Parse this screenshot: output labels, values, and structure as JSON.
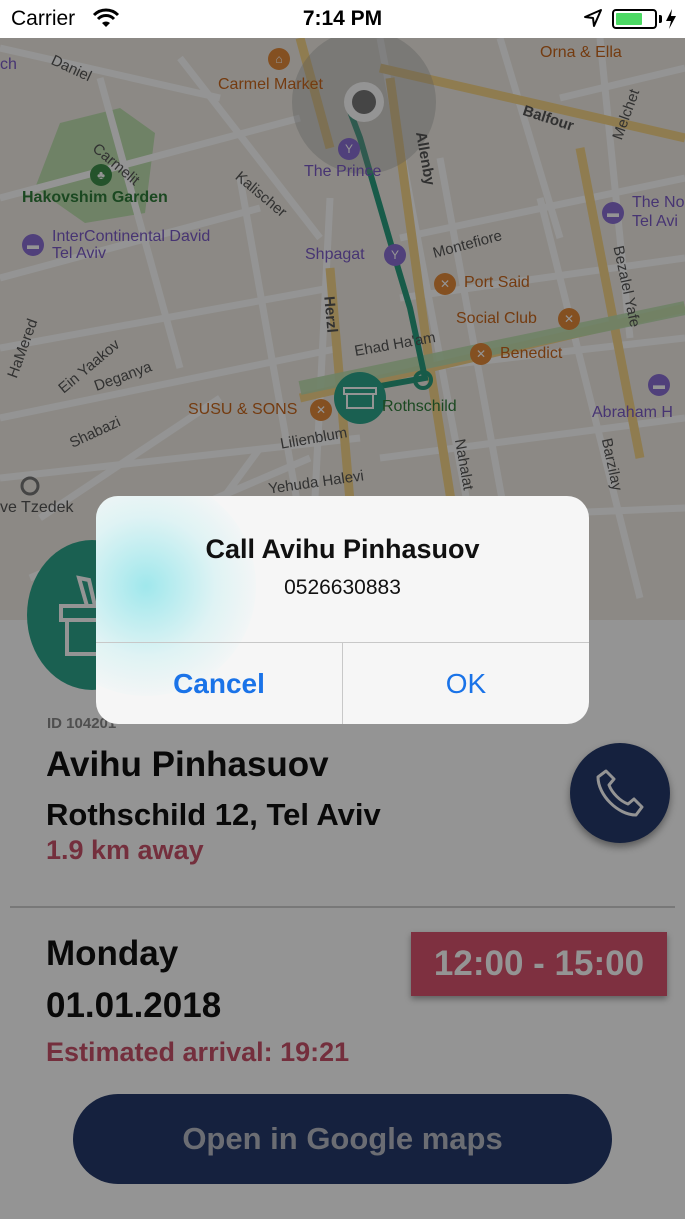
{
  "status_bar": {
    "carrier": "Carrier",
    "time": "7:14 PM",
    "battery_level": 0.7,
    "icons": [
      "wifi-icon",
      "location-arrow-icon",
      "battery-icon",
      "charging-bolt-icon"
    ]
  },
  "map": {
    "streets": [
      "Daniel",
      "Carmelit",
      "Kalischer",
      "Balfour",
      "Melchet",
      "Allenby",
      "Montefiore",
      "Bezalel Yafe",
      "HaMered",
      "Ein Yaakov",
      "Deganya",
      "Shabazi",
      "Herzl",
      "Ehad Ha'am",
      "Lilienblum",
      "Yehuda Halevi",
      "Nahalat",
      "Barzilay"
    ],
    "pois": [
      "Carmel Market",
      "Orna & Ella",
      "The Prince",
      "Hakovshim Garden",
      "InterContinental David Tel Aviv",
      "Shpagat",
      "Port Said",
      "Social Club",
      "Benedict",
      "SUSU & SONS",
      "Rothschild",
      "The No",
      "Tel Avi",
      "Abraham H",
      "ve Tzedek",
      "ch"
    ],
    "colors": {
      "route": "#2a9d7e",
      "marker": "#2ea58c"
    }
  },
  "details": {
    "id_label": "ID 104201",
    "name": "Avihu Pinhasuov",
    "address": "Rothschild 12, Tel Aviv",
    "distance": "1.9 km away",
    "day": "Monday",
    "date": "01.01.2018",
    "estimated_arrival": "Estimated arrival: 19:21",
    "time_window": "12:00 - 15:00",
    "maps_button": "Open in Google maps",
    "colors": {
      "accent": "#d9536e",
      "button": "#253a6b",
      "avatar": "#2ea58c"
    }
  },
  "alert": {
    "title": "Call Avihu Pinhasuov",
    "message": "0526630883",
    "cancel_label": "Cancel",
    "ok_label": "OK",
    "colors": {
      "button_text": "#1a73e8"
    }
  }
}
